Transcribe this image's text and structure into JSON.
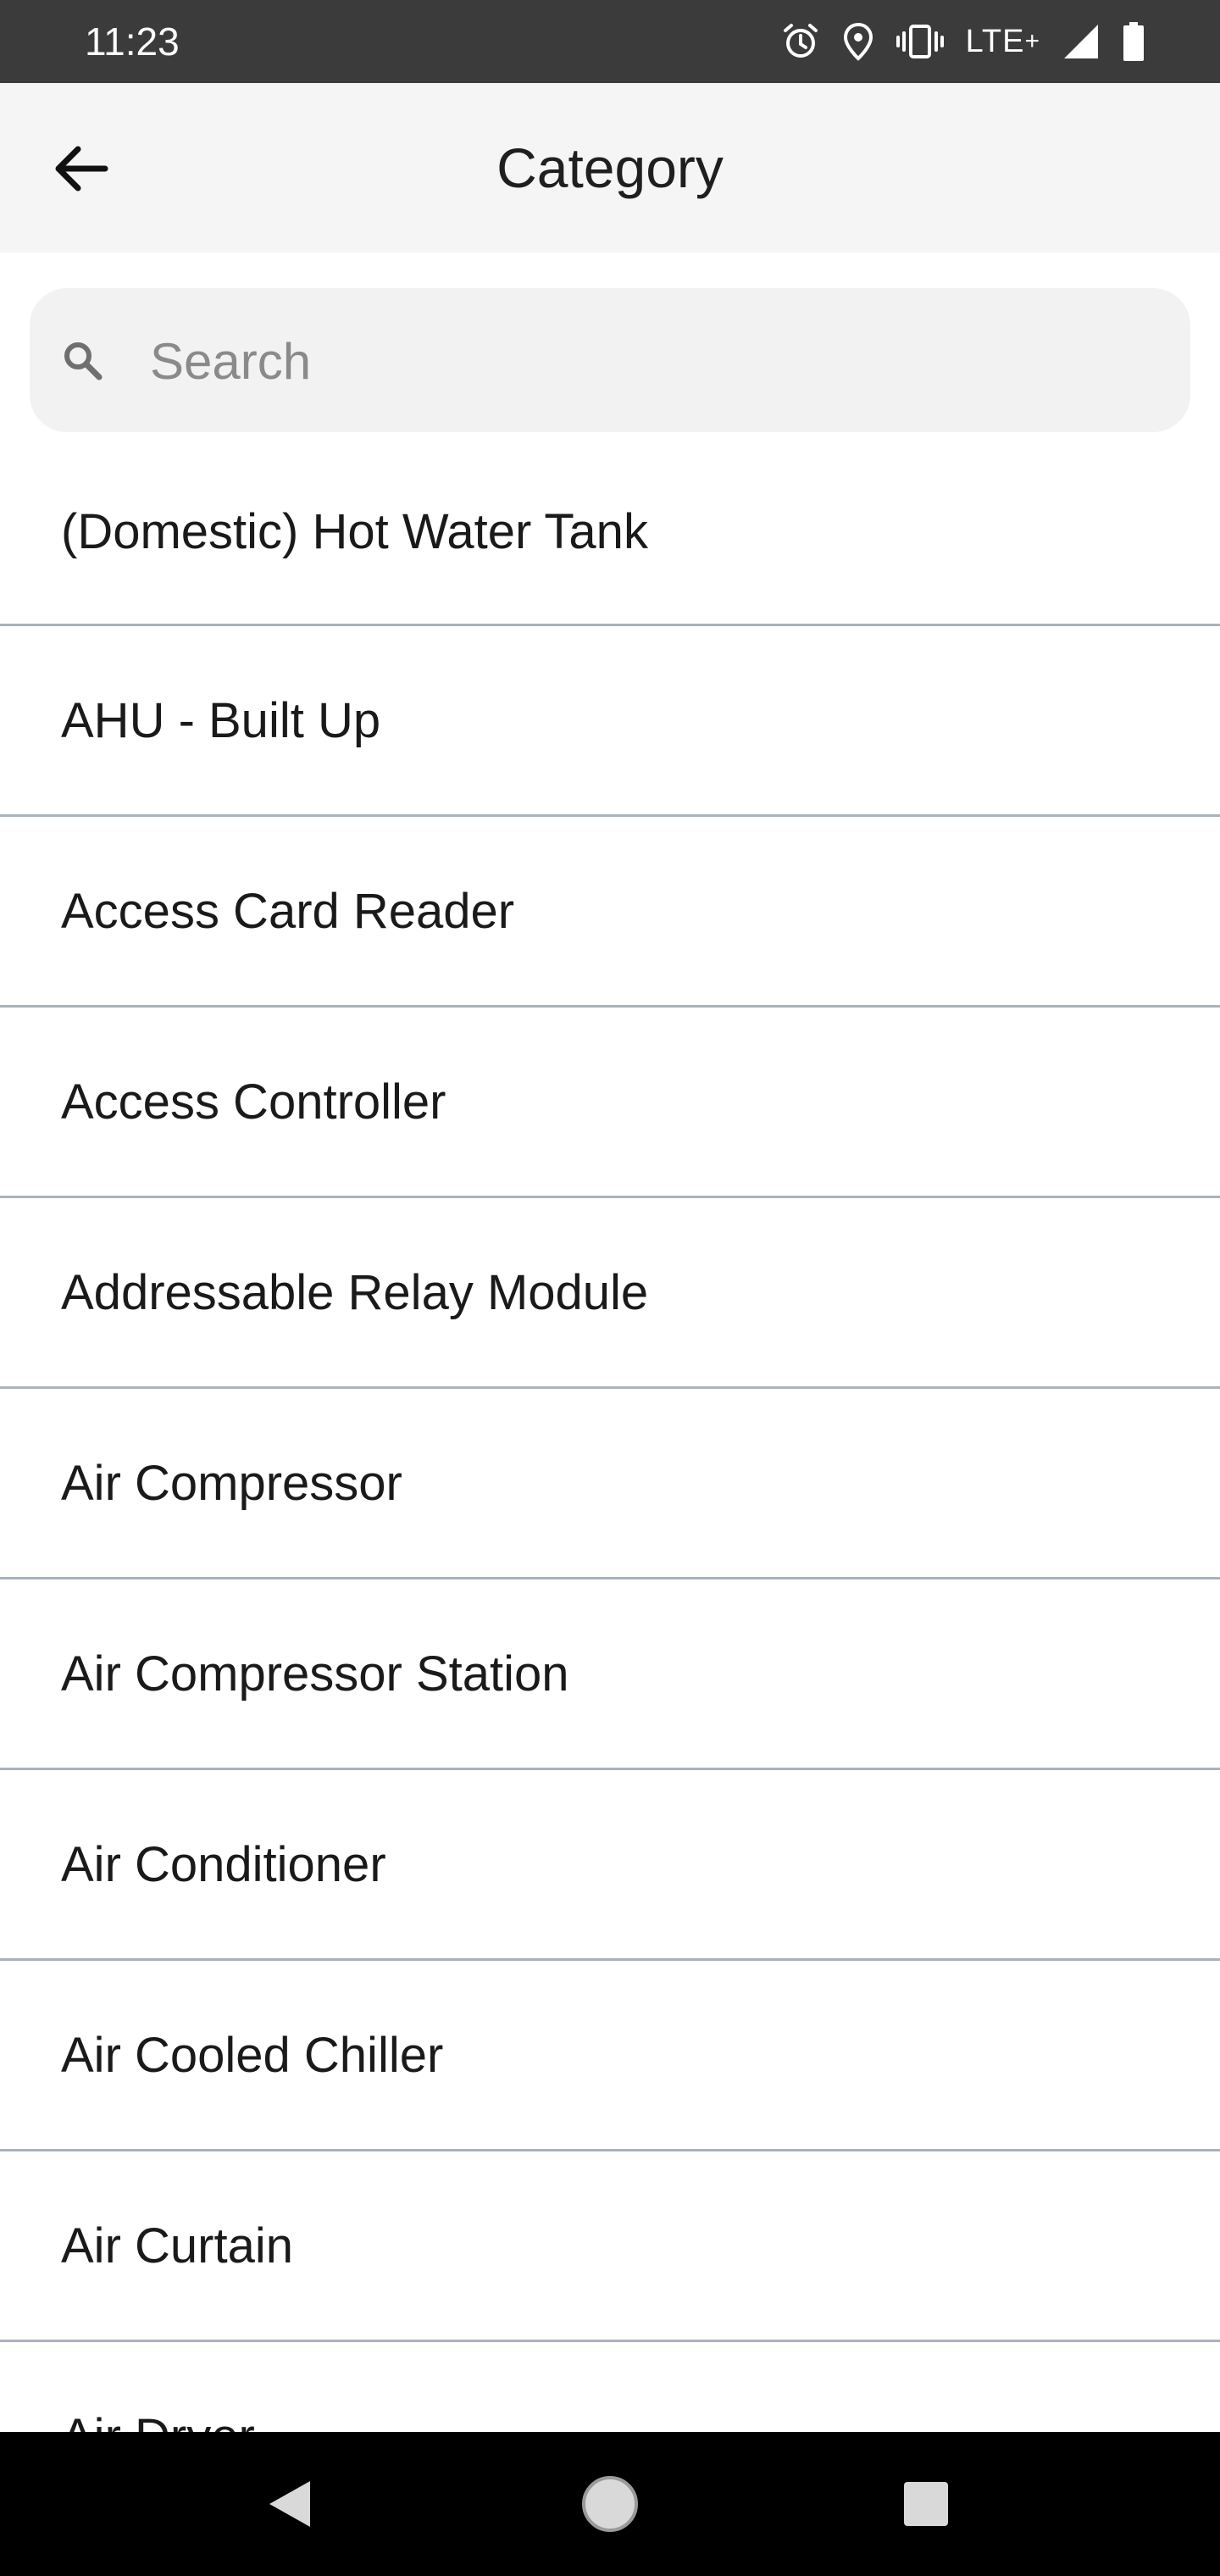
{
  "status_bar": {
    "time": "11:23",
    "network": "LTE",
    "network_superscript": "+",
    "icons": [
      "alarm-icon",
      "location-icon",
      "vibrate-icon",
      "lte-label",
      "signal-icon",
      "battery-icon"
    ]
  },
  "app_bar": {
    "title": "Category",
    "back_icon": "arrow-left-icon"
  },
  "search": {
    "placeholder": "Search",
    "value": "",
    "icon": "search-icon"
  },
  "categories": [
    "(Domestic) Hot Water Tank",
    "AHU - Built Up",
    "Access Card Reader",
    "Access Controller",
    "Addressable Relay Module",
    "Air Compressor",
    "Air Compressor Station",
    "Air Conditioner",
    "Air Cooled Chiller",
    "Air Curtain",
    "Air Dryer"
  ],
  "nav_bar": {
    "buttons": [
      "back-triangle-icon",
      "home-circle-icon",
      "recents-square-icon"
    ]
  },
  "colors": {
    "status_bar_bg": "#3b3b3b",
    "app_bar_bg": "#f5f5f5",
    "search_bg": "#f2f2f2",
    "divider": "#a7b3bd",
    "nav_bar_bg": "#000000"
  }
}
